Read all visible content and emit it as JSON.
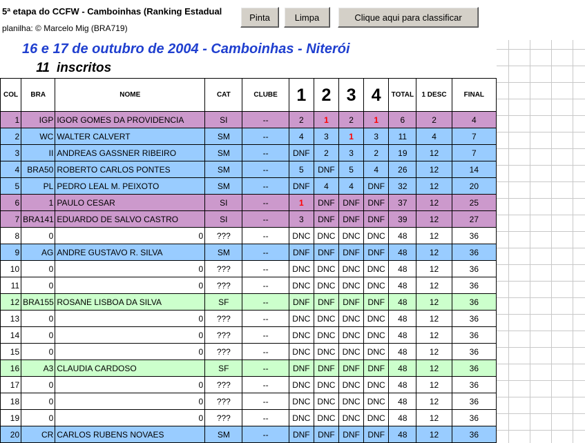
{
  "header": {
    "title": "5ª etapa do CCFW - Camboinhas (Ranking Estadual",
    "credit": "planilha: © Marcelo Mig (BRA719)"
  },
  "buttons": {
    "pinta": "Pinta",
    "limpa": "Limpa",
    "classificar": "Clique aqui para classificar"
  },
  "event": {
    "subtitle": "16 e 17 de outubro de 2004 - Camboinhas - Niterói",
    "inscritos_count": "11",
    "inscritos_label": "inscritos"
  },
  "colors": {
    "purple": "#cc99cc",
    "blue": "#99ccff",
    "green": "#ccffcc",
    "subtitle": "#1f3fcf",
    "highlight": "#ff0000"
  },
  "table": {
    "headers": [
      "COL",
      "BRA",
      "NOME",
      "CAT",
      "CLUBE",
      "1",
      "2",
      "3",
      "4",
      "TOTAL",
      "1 DESC",
      "FINAL"
    ],
    "rows": [
      {
        "col": "1",
        "bra": "IGP",
        "nome": "IGOR GOMES DA PROVIDENCIA",
        "cat": "SI",
        "clube": "--",
        "r": [
          "2",
          "1",
          "2",
          "1"
        ],
        "red": [
          false,
          true,
          false,
          true
        ],
        "total": "6",
        "desc": "2",
        "final": "4",
        "color": "purple"
      },
      {
        "col": "2",
        "bra": "WC",
        "nome": "WALTER CALVERT",
        "cat": "SM",
        "clube": "--",
        "r": [
          "4",
          "3",
          "1",
          "3"
        ],
        "red": [
          false,
          false,
          true,
          false
        ],
        "total": "11",
        "desc": "4",
        "final": "7",
        "color": "blue"
      },
      {
        "col": "3",
        "bra": "II",
        "nome": "ANDREAS GASSNER RIBEIRO",
        "cat": "SM",
        "clube": "--",
        "r": [
          "DNF",
          "2",
          "3",
          "2"
        ],
        "red": [
          false,
          false,
          false,
          false
        ],
        "total": "19",
        "desc": "12",
        "final": "7",
        "color": "blue"
      },
      {
        "col": "4",
        "bra": "BRA50",
        "nome": "ROBERTO CARLOS PONTES",
        "cat": "SM",
        "clube": "--",
        "r": [
          "5",
          "DNF",
          "5",
          "4"
        ],
        "red": [
          false,
          false,
          false,
          false
        ],
        "total": "26",
        "desc": "12",
        "final": "14",
        "color": "blue"
      },
      {
        "col": "5",
        "bra": "PL",
        "nome": "PEDRO LEAL M. PEIXOTO",
        "cat": "SM",
        "clube": "--",
        "r": [
          "DNF",
          "4",
          "4",
          "DNF"
        ],
        "red": [
          false,
          false,
          false,
          false
        ],
        "total": "32",
        "desc": "12",
        "final": "20",
        "color": "blue"
      },
      {
        "col": "6",
        "bra": "1",
        "nome": "PAULO CESAR",
        "cat": "SI",
        "clube": "--",
        "r": [
          "1",
          "DNF",
          "DNF",
          "DNF"
        ],
        "red": [
          true,
          false,
          false,
          false
        ],
        "total": "37",
        "desc": "12",
        "final": "25",
        "color": "purple"
      },
      {
        "col": "7",
        "bra": "BRA141",
        "nome": "EDUARDO DE SALVO CASTRO",
        "cat": "SI",
        "clube": "--",
        "r": [
          "3",
          "DNF",
          "DNF",
          "DNF"
        ],
        "red": [
          false,
          false,
          false,
          false
        ],
        "total": "39",
        "desc": "12",
        "final": "27",
        "color": "purple"
      },
      {
        "col": "8",
        "bra": "0",
        "nome": "0",
        "cat": "???",
        "clube": "--",
        "r": [
          "DNC",
          "DNC",
          "DNC",
          "DNC"
        ],
        "red": [
          false,
          false,
          false,
          false
        ],
        "total": "48",
        "desc": "12",
        "final": "36",
        "color": "white"
      },
      {
        "col": "9",
        "bra": "AG",
        "nome": "ANDRE GUSTAVO R. SILVA",
        "cat": "SM",
        "clube": "--",
        "r": [
          "DNF",
          "DNF",
          "DNF",
          "DNF"
        ],
        "red": [
          false,
          false,
          false,
          false
        ],
        "total": "48",
        "desc": "12",
        "final": "36",
        "color": "blue"
      },
      {
        "col": "10",
        "bra": "0",
        "nome": "0",
        "cat": "???",
        "clube": "--",
        "r": [
          "DNC",
          "DNC",
          "DNC",
          "DNC"
        ],
        "red": [
          false,
          false,
          false,
          false
        ],
        "total": "48",
        "desc": "12",
        "final": "36",
        "color": "white"
      },
      {
        "col": "11",
        "bra": "0",
        "nome": "0",
        "cat": "???",
        "clube": "--",
        "r": [
          "DNC",
          "DNC",
          "DNC",
          "DNC"
        ],
        "red": [
          false,
          false,
          false,
          false
        ],
        "total": "48",
        "desc": "12",
        "final": "36",
        "color": "white"
      },
      {
        "col": "12",
        "bra": "BRA155",
        "nome": "ROSANE LISBOA DA SILVA",
        "cat": "SF",
        "clube": "--",
        "r": [
          "DNF",
          "DNF",
          "DNF",
          "DNF"
        ],
        "red": [
          false,
          false,
          false,
          false
        ],
        "total": "48",
        "desc": "12",
        "final": "36",
        "color": "green"
      },
      {
        "col": "13",
        "bra": "0",
        "nome": "0",
        "cat": "???",
        "clube": "--",
        "r": [
          "DNC",
          "DNC",
          "DNC",
          "DNC"
        ],
        "red": [
          false,
          false,
          false,
          false
        ],
        "total": "48",
        "desc": "12",
        "final": "36",
        "color": "white"
      },
      {
        "col": "14",
        "bra": "0",
        "nome": "0",
        "cat": "???",
        "clube": "--",
        "r": [
          "DNC",
          "DNC",
          "DNC",
          "DNC"
        ],
        "red": [
          false,
          false,
          false,
          false
        ],
        "total": "48",
        "desc": "12",
        "final": "36",
        "color": "white"
      },
      {
        "col": "15",
        "bra": "0",
        "nome": "0",
        "cat": "???",
        "clube": "--",
        "r": [
          "DNC",
          "DNC",
          "DNC",
          "DNC"
        ],
        "red": [
          false,
          false,
          false,
          false
        ],
        "total": "48",
        "desc": "12",
        "final": "36",
        "color": "white"
      },
      {
        "col": "16",
        "bra": "A3",
        "nome": "CLAUDIA CARDOSO",
        "cat": "SF",
        "clube": "--",
        "r": [
          "DNF",
          "DNF",
          "DNF",
          "DNF"
        ],
        "red": [
          false,
          false,
          false,
          false
        ],
        "total": "48",
        "desc": "12",
        "final": "36",
        "color": "green"
      },
      {
        "col": "17",
        "bra": "0",
        "nome": "0",
        "cat": "???",
        "clube": "--",
        "r": [
          "DNC",
          "DNC",
          "DNC",
          "DNC"
        ],
        "red": [
          false,
          false,
          false,
          false
        ],
        "total": "48",
        "desc": "12",
        "final": "36",
        "color": "white"
      },
      {
        "col": "18",
        "bra": "0",
        "nome": "0",
        "cat": "???",
        "clube": "--",
        "r": [
          "DNC",
          "DNC",
          "DNC",
          "DNC"
        ],
        "red": [
          false,
          false,
          false,
          false
        ],
        "total": "48",
        "desc": "12",
        "final": "36",
        "color": "white"
      },
      {
        "col": "19",
        "bra": "0",
        "nome": "0",
        "cat": "???",
        "clube": "--",
        "r": [
          "DNC",
          "DNC",
          "DNC",
          "DNC"
        ],
        "red": [
          false,
          false,
          false,
          false
        ],
        "total": "48",
        "desc": "12",
        "final": "36",
        "color": "white"
      },
      {
        "col": "20",
        "bra": "CR",
        "nome": "CARLOS RUBENS NOVAES",
        "cat": "SM",
        "clube": "--",
        "r": [
          "DNF",
          "DNF",
          "DNF",
          "DNF"
        ],
        "red": [
          false,
          false,
          false,
          false
        ],
        "total": "48",
        "desc": "12",
        "final": "36",
        "color": "blue"
      }
    ]
  }
}
